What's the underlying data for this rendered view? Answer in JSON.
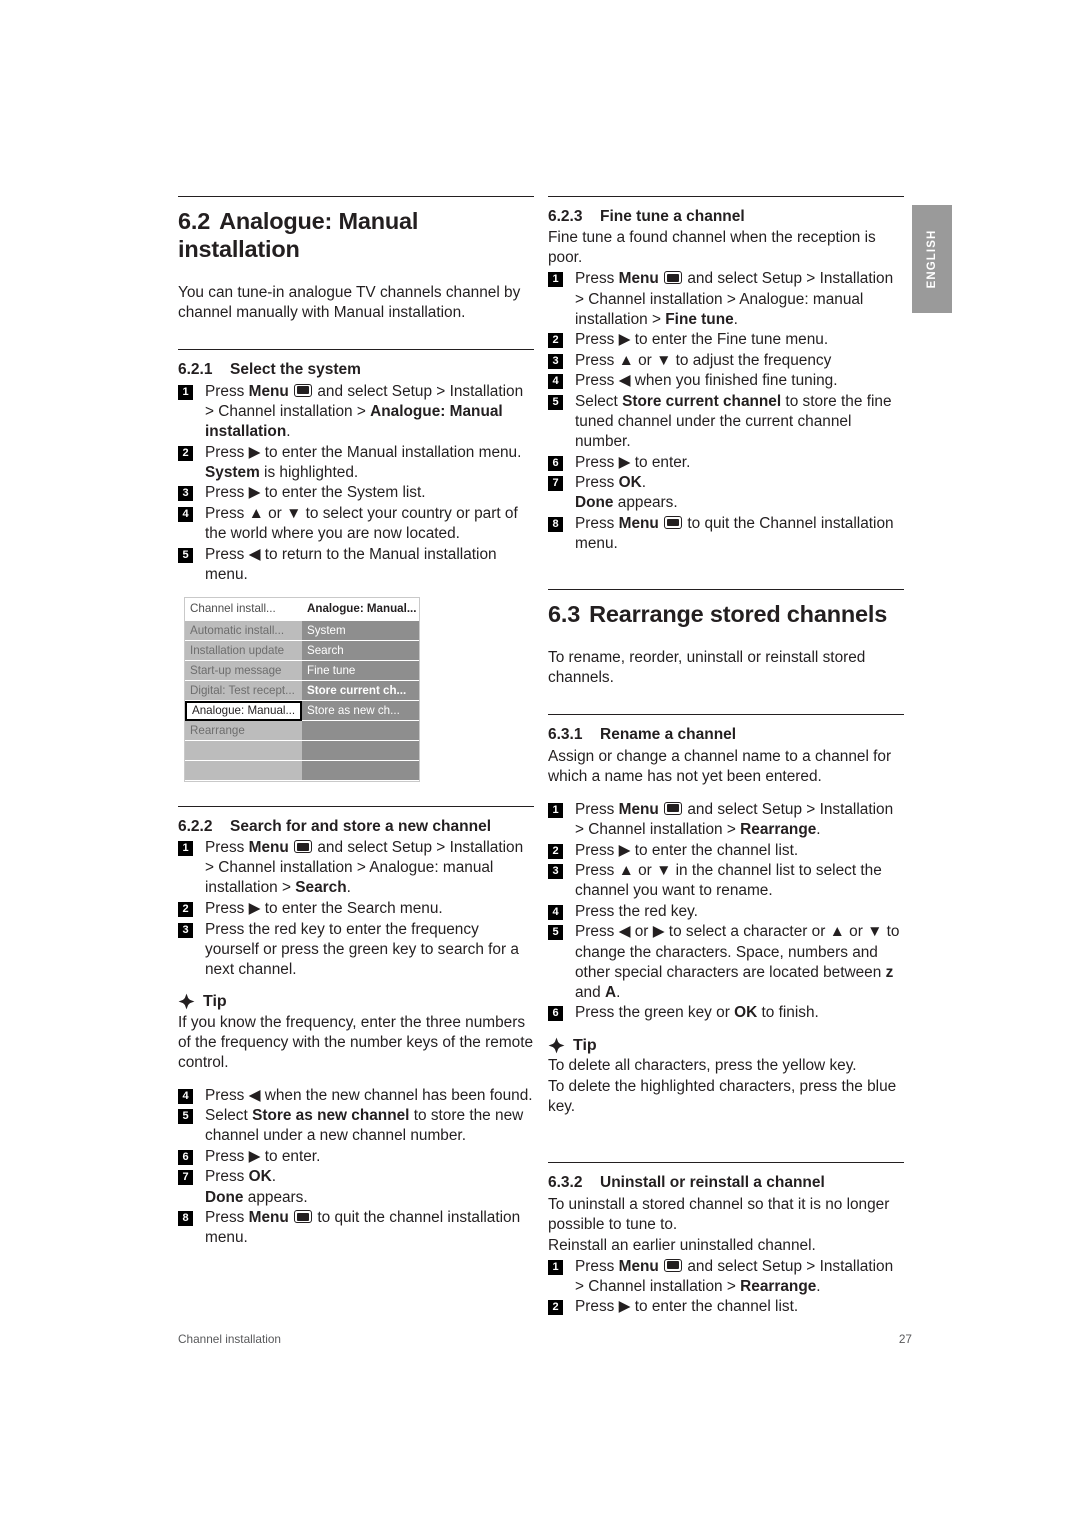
{
  "page": {
    "footer_left": "Channel installation",
    "footer_page_number": "27",
    "language_tab": "ENGLISH"
  },
  "left_column": {
    "chapter": {
      "number": "6.2",
      "title": "Analogue: Manual installation"
    },
    "intro": "You can tune-in analogue TV channels channel by channel manually with Manual installation.",
    "section_621": {
      "number": "6.2.1",
      "title": "Select the system",
      "steps": [
        {
          "n": "1",
          "parts": [
            {
              "t": "Press ",
              "b": false
            },
            {
              "t": "Menu",
              "b": true
            },
            {
              "t": " ",
              "b": false
            },
            {
              "t": "[menu-icon]",
              "b": false
            },
            {
              "t": " and select Setup > Installation > Channel installation > ",
              "b": false
            },
            {
              "t": "Analogue: Manual installation",
              "b": true
            },
            {
              "t": ".",
              "b": false
            }
          ]
        },
        {
          "n": "2",
          "parts": [
            {
              "t": "Press ▶ to enter the Manual installation menu. ",
              "b": false
            },
            {
              "t": "System",
              "b": true
            },
            {
              "t": " is highlighted.",
              "b": false
            }
          ]
        },
        {
          "n": "3",
          "parts": [
            {
              "t": "Press ▶ to enter the System list.",
              "b": false
            }
          ]
        },
        {
          "n": "4",
          "parts": [
            {
              "t": "Press ▲ or ▼ to select your country or part of the world where you are now located.",
              "b": false
            }
          ]
        },
        {
          "n": "5",
          "parts": [
            {
              "t": "Press ◀ to return to the Manual installation menu.",
              "b": false
            }
          ]
        }
      ]
    },
    "tv_menu": {
      "header": {
        "left": "Channel install...",
        "right": "Analogue: Manual..."
      },
      "rows": [
        {
          "left": "Automatic install...",
          "right": "System",
          "selected": false,
          "right_bold": false
        },
        {
          "left": "Installation update",
          "right": "Search",
          "selected": false,
          "right_bold": false
        },
        {
          "left": "Start-up message",
          "right": "Fine tune",
          "selected": false,
          "right_bold": false
        },
        {
          "left": "Digital: Test recept...",
          "right": "Store current ch...",
          "selected": false,
          "right_bold": true
        },
        {
          "left": "Analogue: Manual...",
          "right": "Store as new ch...",
          "selected": true,
          "right_bold": false
        },
        {
          "left": "Rearrange",
          "right": "",
          "selected": false,
          "right_bold": false
        },
        {
          "left": "",
          "right": "",
          "selected": false,
          "right_bold": false
        },
        {
          "left": "",
          "right": "",
          "selected": false,
          "right_bold": false
        }
      ]
    },
    "section_622": {
      "number": "6.2.2",
      "title": "Search for and store a new channel",
      "steps_a": [
        {
          "n": "1",
          "parts": [
            {
              "t": "Press ",
              "b": false
            },
            {
              "t": "Menu",
              "b": true
            },
            {
              "t": " ",
              "b": false
            },
            {
              "t": "[menu-icon]",
              "b": false
            },
            {
              "t": " and select Setup > Installation > Channel installation > Analogue: manual installation > ",
              "b": false
            },
            {
              "t": "Search",
              "b": true
            },
            {
              "t": ".",
              "b": false
            }
          ]
        },
        {
          "n": "2",
          "parts": [
            {
              "t": "Press ▶ to enter the Search menu.",
              "b": false
            }
          ]
        },
        {
          "n": "3",
          "parts": [
            {
              "t": "Press the red key to enter the frequency yourself or press the green key to search for a next channel.",
              "b": false
            }
          ]
        }
      ],
      "tip": {
        "label": "Tip",
        "text": "If you know the frequency, enter the three numbers of the frequency with the number keys of the remote control."
      },
      "steps_b": [
        {
          "n": "4",
          "parts": [
            {
              "t": "Press ◀ when the new channel has been found.",
              "b": false
            }
          ]
        },
        {
          "n": "5",
          "parts": [
            {
              "t": "Select ",
              "b": false
            },
            {
              "t": "Store as new channel",
              "b": true
            },
            {
              "t": " to store the new channel under a new channel number.",
              "b": false
            }
          ]
        },
        {
          "n": "6",
          "parts": [
            {
              "t": "Press ▶ to enter.",
              "b": false
            }
          ]
        },
        {
          "n": "7",
          "parts": [
            {
              "t": "Press ",
              "b": false
            },
            {
              "t": "OK",
              "b": true
            },
            {
              "t": ".",
              "b": false
            },
            {
              "t": "\n",
              "b": false
            },
            {
              "t": "Done",
              "b": true
            },
            {
              "t": " appears.",
              "b": false
            }
          ]
        },
        {
          "n": "8",
          "parts": [
            {
              "t": "Press ",
              "b": false
            },
            {
              "t": "Menu",
              "b": true
            },
            {
              "t": " ",
              "b": false
            },
            {
              "t": "[menu-icon]",
              "b": false
            },
            {
              "t": " to quit the channel installation menu.",
              "b": false
            }
          ]
        }
      ]
    }
  },
  "right_column": {
    "section_623": {
      "number": "6.2.3",
      "title": "Fine tune a channel",
      "intro": "Fine tune a found channel when the reception is poor.",
      "steps": [
        {
          "n": "1",
          "parts": [
            {
              "t": "Press ",
              "b": false
            },
            {
              "t": "Menu",
              "b": true
            },
            {
              "t": " ",
              "b": false
            },
            {
              "t": "[menu-icon]",
              "b": false
            },
            {
              "t": " and select Setup > Installation > Channel installation > Analogue: manual installation > ",
              "b": false
            },
            {
              "t": "Fine tune",
              "b": true
            },
            {
              "t": ".",
              "b": false
            }
          ]
        },
        {
          "n": "2",
          "parts": [
            {
              "t": "Press ▶ to enter the Fine tune menu.",
              "b": false
            }
          ]
        },
        {
          "n": "3",
          "parts": [
            {
              "t": "Press ▲ or ▼ to adjust the frequency",
              "b": false
            }
          ]
        },
        {
          "n": "4",
          "parts": [
            {
              "t": "Press ◀ when you finished fine tuning.",
              "b": false
            }
          ]
        },
        {
          "n": "5",
          "parts": [
            {
              "t": "Select ",
              "b": false
            },
            {
              "t": "Store current channel",
              "b": true
            },
            {
              "t": " to store the fine tuned channel under the current channel number.",
              "b": false
            }
          ]
        },
        {
          "n": "6",
          "parts": [
            {
              "t": "Press ▶ to enter.",
              "b": false
            }
          ]
        },
        {
          "n": "7",
          "parts": [
            {
              "t": "Press ",
              "b": false
            },
            {
              "t": "OK",
              "b": true
            },
            {
              "t": ".",
              "b": false
            },
            {
              "t": "\n",
              "b": false
            },
            {
              "t": "Done",
              "b": true
            },
            {
              "t": " appears.",
              "b": false
            }
          ]
        },
        {
          "n": "8",
          "parts": [
            {
              "t": "Press ",
              "b": false
            },
            {
              "t": "Menu",
              "b": true
            },
            {
              "t": " ",
              "b": false
            },
            {
              "t": "[menu-icon]",
              "b": false
            },
            {
              "t": " to quit the Channel installation menu.",
              "b": false
            }
          ]
        }
      ]
    },
    "chapter": {
      "number": "6.3",
      "title": "Rearrange stored channels"
    },
    "chapter_intro": "To rename, reorder, uninstall or reinstall stored channels.",
    "section_631": {
      "number": "6.3.1",
      "title": "Rename a channel",
      "intro": "Assign or change a channel name to a channel for which a name has not yet been entered.",
      "steps": [
        {
          "n": "1",
          "parts": [
            {
              "t": "Press ",
              "b": false
            },
            {
              "t": "Menu",
              "b": true
            },
            {
              "t": " ",
              "b": false
            },
            {
              "t": "[menu-icon]",
              "b": false
            },
            {
              "t": " and select Setup > Installation > Channel installation > ",
              "b": false
            },
            {
              "t": "Rearrange",
              "b": true
            },
            {
              "t": ".",
              "b": false
            }
          ]
        },
        {
          "n": "2",
          "parts": [
            {
              "t": "Press ▶ to enter the channel list.",
              "b": false
            }
          ]
        },
        {
          "n": "3",
          "parts": [
            {
              "t": "Press ▲ or ▼ in the channel list to select the channel you want to rename.",
              "b": false
            }
          ]
        },
        {
          "n": "4",
          "parts": [
            {
              "t": "Press the red key.",
              "b": false
            }
          ]
        },
        {
          "n": "5",
          "parts": [
            {
              "t": "Press ◀ or ▶ to select a character or ▲ or ▼ to change the characters. Space, numbers and other special characters are located between ",
              "b": false
            },
            {
              "t": "z",
              "b": true
            },
            {
              "t": " and ",
              "b": false
            },
            {
              "t": "A",
              "b": true
            },
            {
              "t": ".",
              "b": false
            }
          ]
        },
        {
          "n": "6",
          "parts": [
            {
              "t": "Press the green key or ",
              "b": false
            },
            {
              "t": "OK",
              "b": true
            },
            {
              "t": " to finish.",
              "b": false
            }
          ]
        }
      ],
      "tip": {
        "label": "Tip",
        "line1": "To delete all characters, press the yellow key.",
        "line2": "To delete the highlighted characters, press the blue key."
      }
    },
    "section_632": {
      "number": "6.3.2",
      "title": "Uninstall or reinstall a channel",
      "intro1": "To uninstall a stored channel so that it is no longer possible to tune to.",
      "intro2": "Reinstall an earlier uninstalled channel.",
      "steps": [
        {
          "n": "1",
          "parts": [
            {
              "t": "Press ",
              "b": false
            },
            {
              "t": "Menu",
              "b": true
            },
            {
              "t": " ",
              "b": false
            },
            {
              "t": "[menu-icon]",
              "b": false
            },
            {
              "t": " and select Setup > Installation > Channel installation > ",
              "b": false
            },
            {
              "t": "Rearrange",
              "b": true
            },
            {
              "t": ".",
              "b": false
            }
          ]
        },
        {
          "n": "2",
          "parts": [
            {
              "t": "Press ▶ to enter the channel list.",
              "b": false
            }
          ]
        }
      ]
    }
  }
}
